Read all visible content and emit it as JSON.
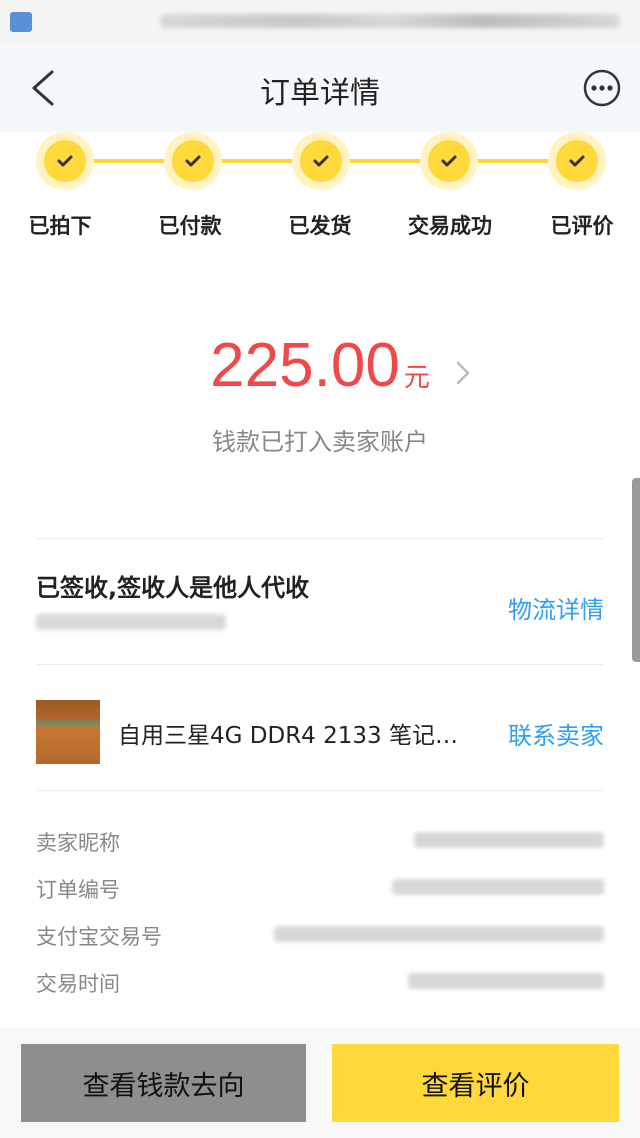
{
  "header": {
    "title": "订单详情"
  },
  "steps": [
    {
      "label": "已拍下"
    },
    {
      "label": "已付款"
    },
    {
      "label": "已发货"
    },
    {
      "label": "交易成功"
    },
    {
      "label": "已评价"
    }
  ],
  "payment": {
    "amount": "225.00",
    "unit": "元",
    "status": "钱款已打入卖家账户"
  },
  "logistics": {
    "status": "已签收,签收人是他人代收",
    "link": "物流详情"
  },
  "product": {
    "title": "自用三星4G DDR4 2133 笔记本…",
    "contact_link": "联系卖家"
  },
  "info": {
    "seller_nickname_label": "卖家昵称",
    "order_no_label": "订单编号",
    "alipay_no_label": "支付宝交易号",
    "trade_time_label": "交易时间"
  },
  "actions": {
    "money_flow": "查看钱款去向",
    "view_review": "查看评价"
  },
  "colors": {
    "accent_yellow": "#ffd93b",
    "amount_red": "#f2484a",
    "link_blue": "#2f9ff2",
    "button_gray": "#8e8e8e"
  },
  "icons": {
    "back": "chevron-left-icon",
    "more": "more-dots-icon",
    "step": "check-icon",
    "amount_arrow": "chevron-right-icon"
  }
}
